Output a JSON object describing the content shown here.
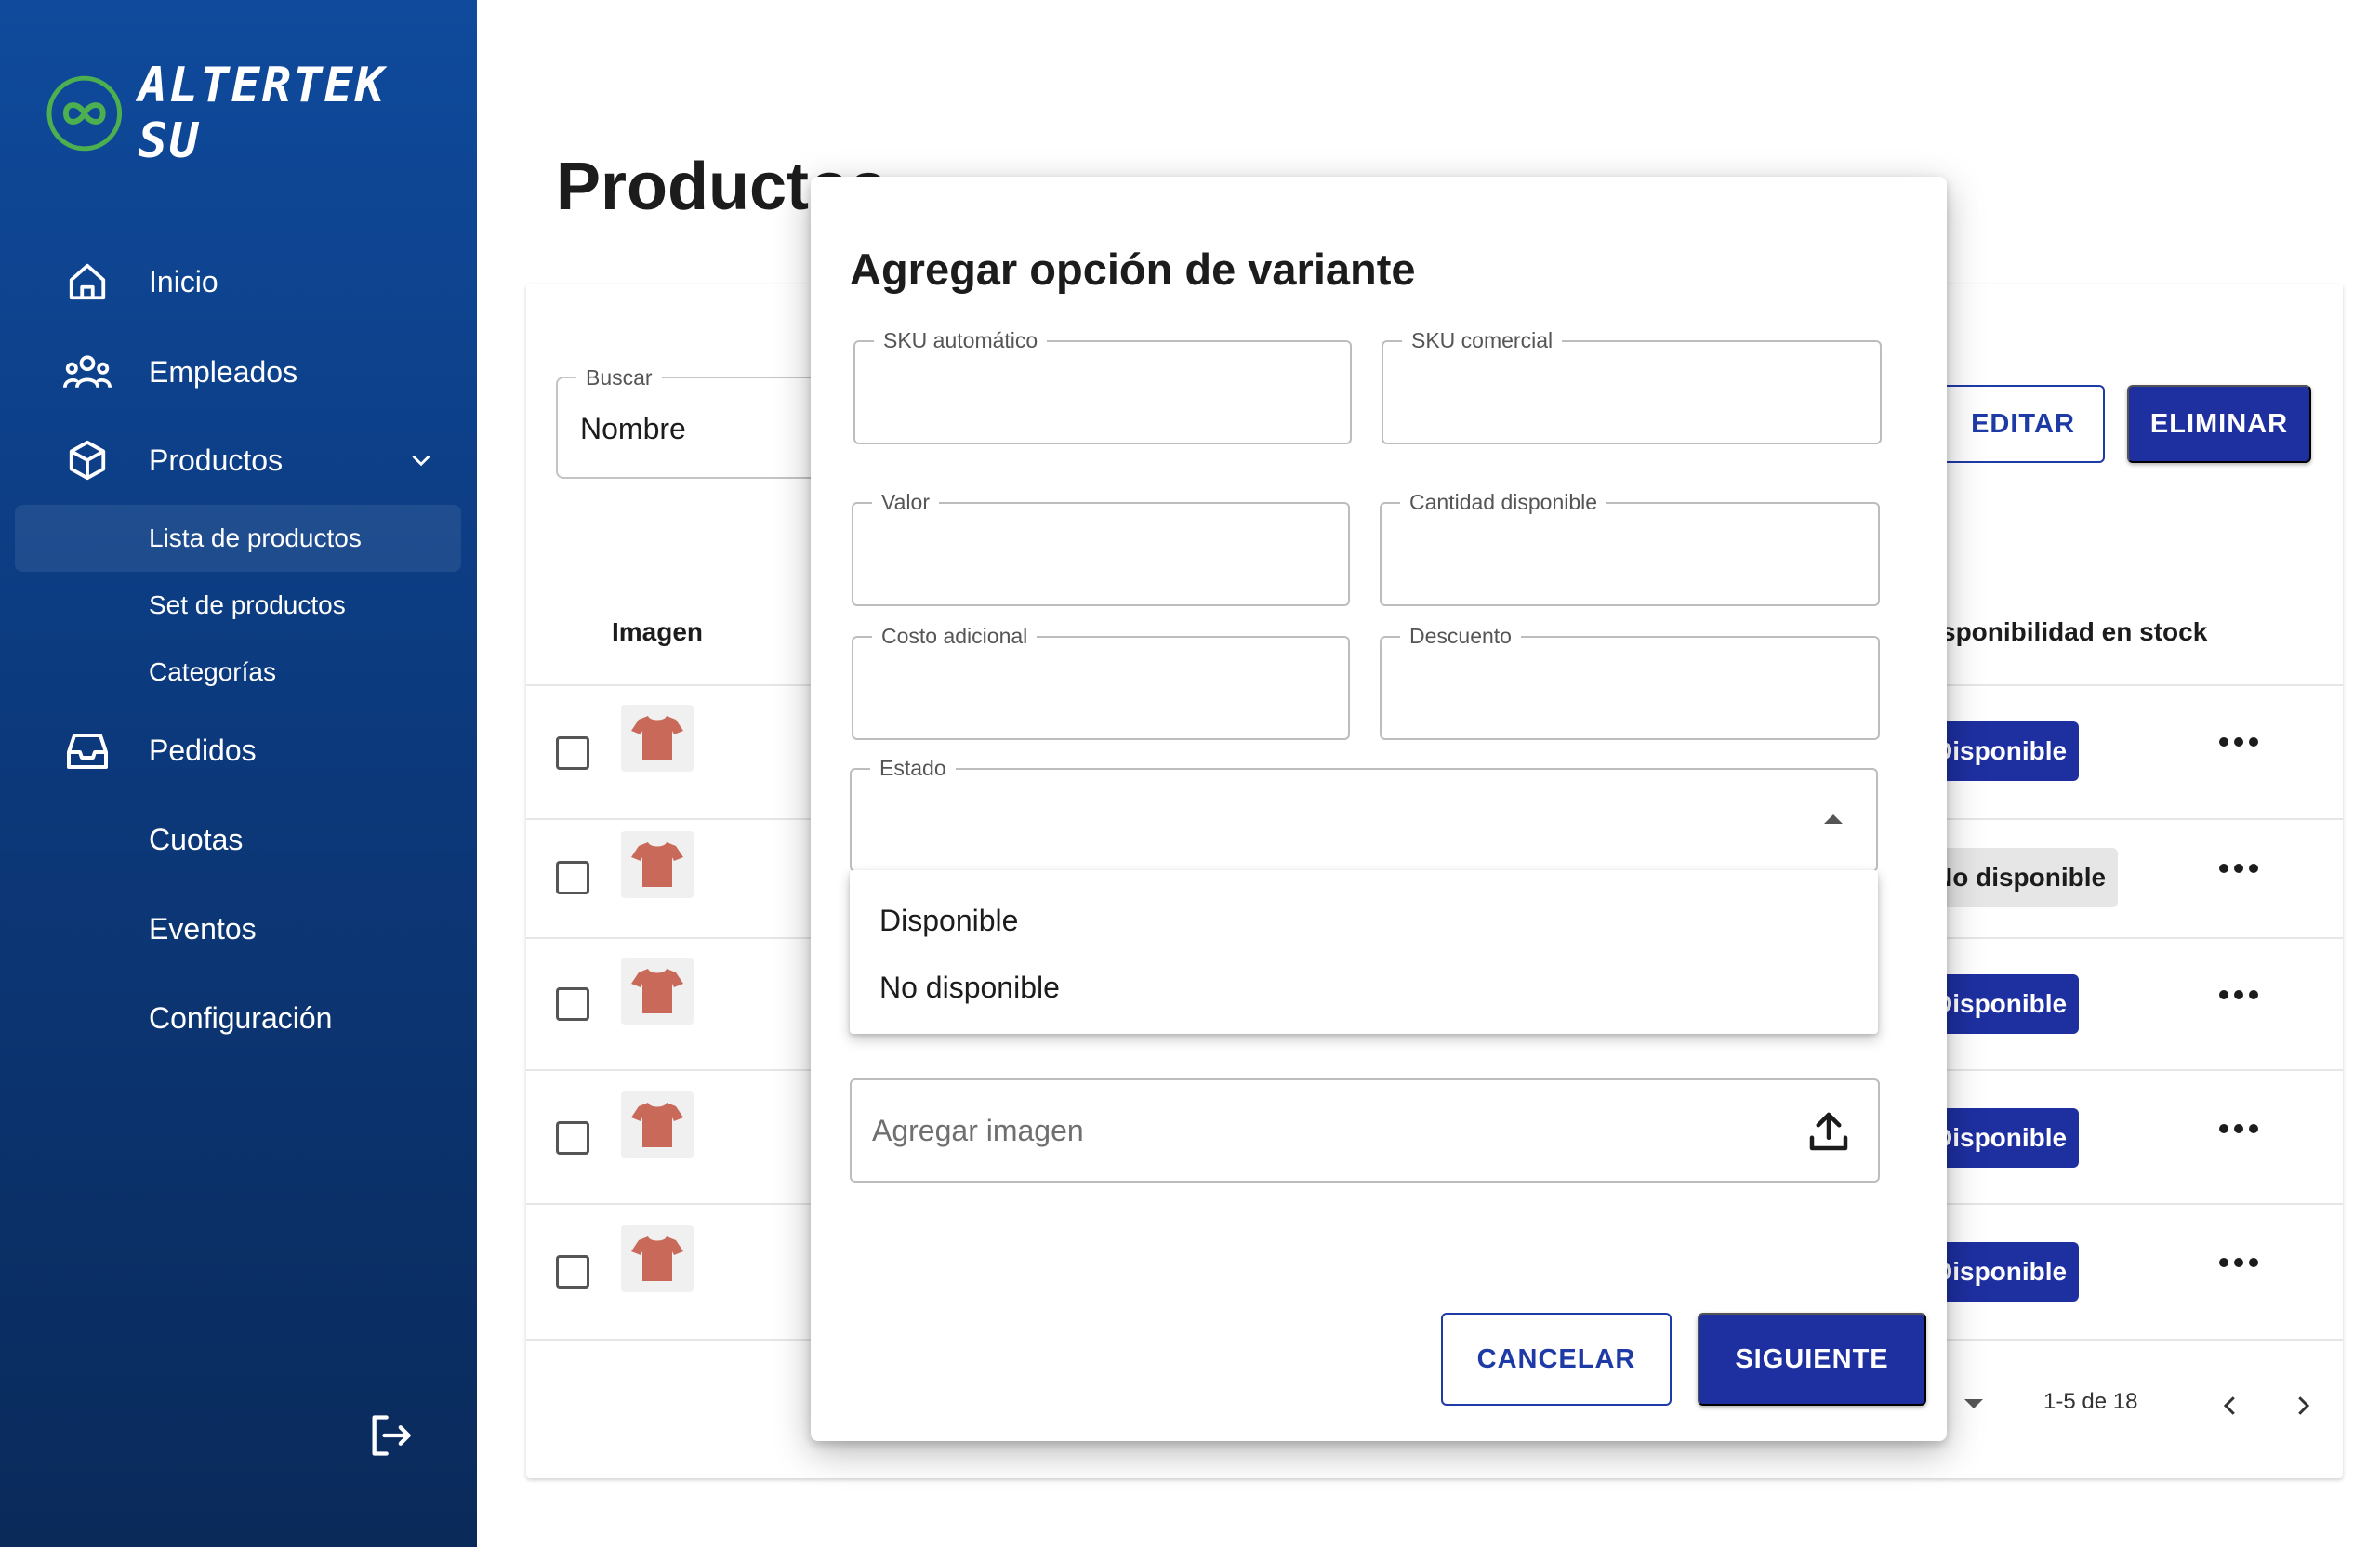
{
  "brand": {
    "name": "ALTERTEK SU",
    "accent": "#1e2fa0",
    "logo_green": "#4caf50"
  },
  "sidebar": {
    "items": [
      {
        "label": "Inicio",
        "icon": "home-icon"
      },
      {
        "label": "Empleados",
        "icon": "people-icon"
      },
      {
        "label": "Productos",
        "icon": "box-icon",
        "expanded": true
      },
      {
        "label": "Pedidos",
        "icon": "inbox-icon"
      },
      {
        "label": "Cuotas"
      },
      {
        "label": "Eventos"
      },
      {
        "label": "Configuración"
      }
    ],
    "subitems": [
      {
        "label": "Lista de productos",
        "active": true
      },
      {
        "label": "Set de productos"
      },
      {
        "label": "Categorías"
      }
    ],
    "logout_icon": "logout-icon"
  },
  "main": {
    "title": "Productos",
    "search": {
      "label": "Buscar",
      "value": "Nombre"
    },
    "edit_label": "EDITAR",
    "delete_label": "ELIMINAR",
    "columns": {
      "image": "Imagen",
      "stock": "Disponibilidad en stock"
    },
    "rows": [
      {
        "status": "Disponible",
        "available": true
      },
      {
        "status": "No disponible",
        "available": false
      },
      {
        "status": "Disponible",
        "available": true
      },
      {
        "status": "Disponible",
        "available": true
      },
      {
        "status": "Disponible",
        "available": true
      }
    ],
    "pagination": {
      "range": "1-5 de 18"
    }
  },
  "dialog": {
    "title": "Agregar opción de variante",
    "fields": {
      "sku_auto": "SKU automático",
      "sku_commercial": "SKU comercial",
      "value": "Valor",
      "quantity": "Cantidad disponible",
      "extra_cost": "Costo adicional",
      "discount": "Descuento",
      "status": "Estado"
    },
    "status_options": [
      "Disponible",
      "No disponible"
    ],
    "image_placeholder": "Agregar imagen",
    "cancel_label": "CANCELAR",
    "next_label": "SIGUIENTE"
  }
}
